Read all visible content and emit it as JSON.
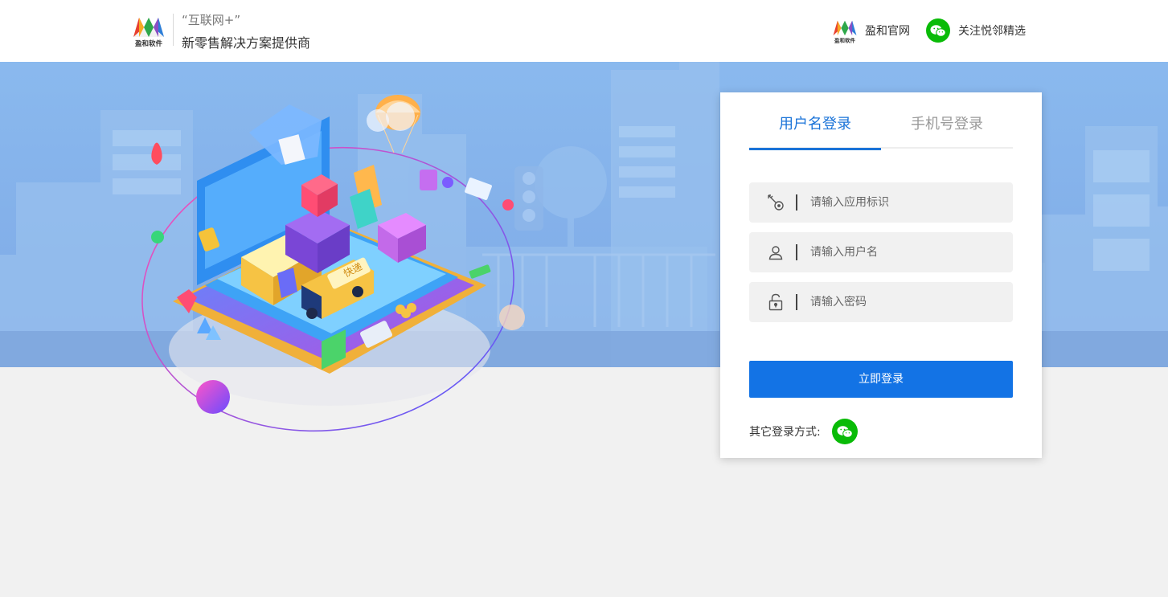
{
  "header": {
    "brand_line1": "“互联网+”",
    "brand_line2": "新零售解决方案提供商",
    "official_site": "盈和官网",
    "follow_wechat": "关注悦邻精选"
  },
  "login": {
    "tabs": [
      {
        "label": "用户名登录",
        "active": true
      },
      {
        "label": "手机号登录",
        "active": false
      }
    ],
    "fields": [
      {
        "icon": "key-icon",
        "placeholder": "请输入应用标识",
        "value": ""
      },
      {
        "icon": "user-icon",
        "placeholder": "请输入用户名",
        "value": ""
      },
      {
        "icon": "lock-icon",
        "placeholder": "请输入密码",
        "value": ""
      }
    ],
    "submit_label": "立即登录",
    "other_methods_label": "其它登录方式:"
  },
  "colors": {
    "accent": "#1373e5",
    "tab_active": "#1a73d8",
    "wechat": "#09bb07",
    "banner": "#86b5ec",
    "page_bg": "#f1f1f1"
  }
}
